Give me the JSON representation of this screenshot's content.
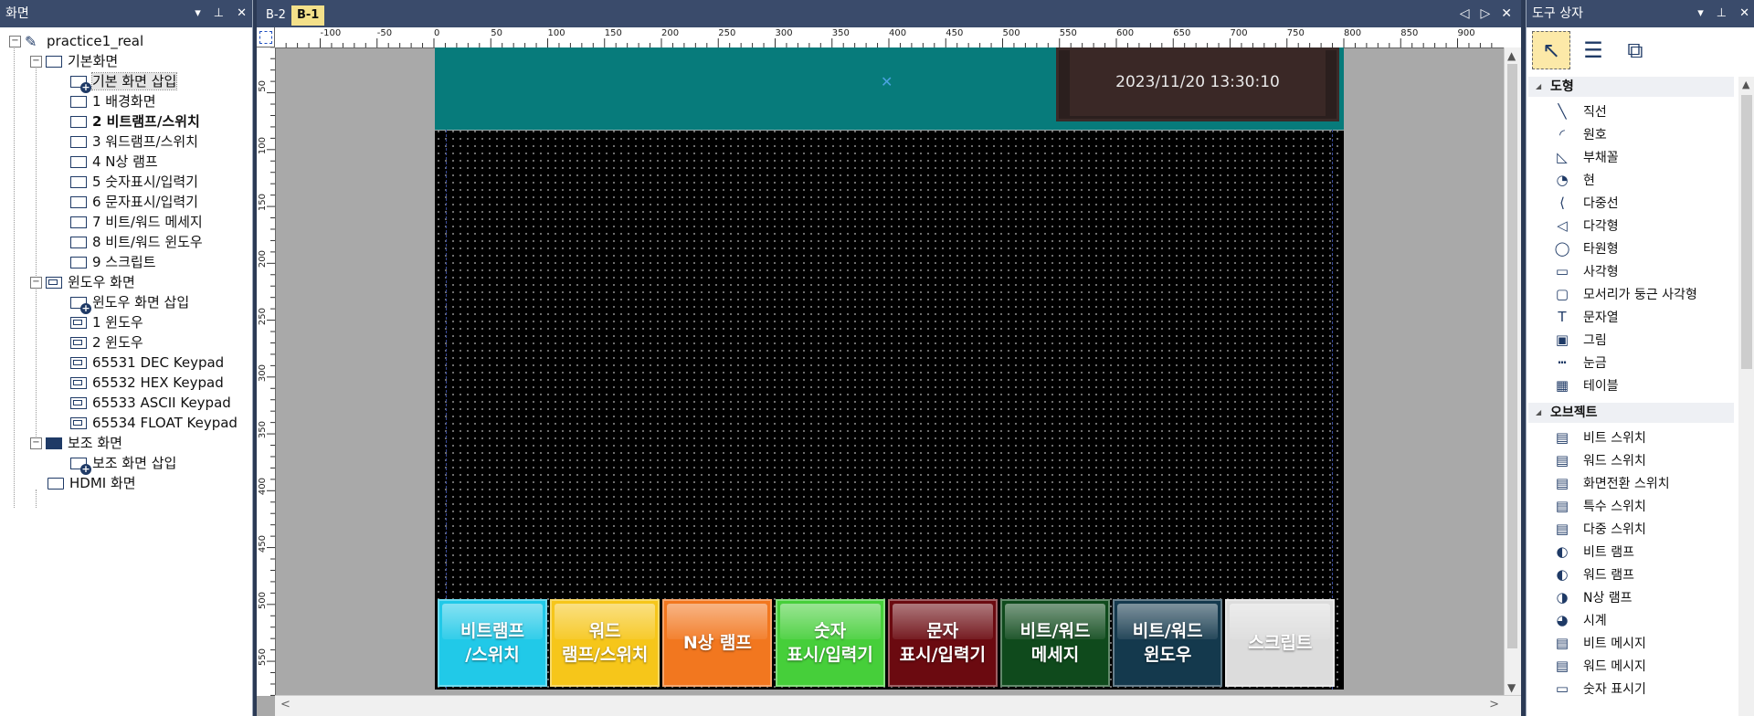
{
  "left_panel": {
    "title": "화면",
    "tree": {
      "project": "practice1_real",
      "base_group": "기본화면",
      "base_items": [
        "기본 화면 삽입",
        "1 배경화면",
        "2 비트램프/스위치",
        "3 워드램프/스위치",
        "4 N상 램프",
        "5 숫자표시/입력기",
        "6 문자표시/입력기",
        "7 비트/워드 메세지",
        "8 비트/워드 윈도우",
        "9 스크립트"
      ],
      "window_group": "윈도우 화면",
      "window_items": [
        "윈도우 화면 삽입",
        "1 윈도우",
        "2 윈도우",
        "65531 DEC Keypad",
        "65532 HEX Keypad",
        "65533 ASCII Keypad",
        "65534 FLOAT Keypad"
      ],
      "aux_group": "보조 화면",
      "aux_items": [
        "보조 화면 삽입"
      ],
      "hdmi": "HDMI 화면"
    }
  },
  "center": {
    "tabs": [
      "B-2",
      "B-1"
    ],
    "hruler_ticks": [
      "-100",
      "-50",
      "0",
      "50",
      "100",
      "150",
      "200",
      "250",
      "300",
      "350",
      "400",
      "450",
      "500",
      "550",
      "600",
      "650",
      "700",
      "750",
      "800",
      "850",
      "900"
    ],
    "vruler_ticks": [
      "50",
      "100",
      "150",
      "200",
      "250",
      "300",
      "350",
      "400",
      "450",
      "500",
      "550"
    ],
    "clock_text": "2023/11/20   13:30:10",
    "buttons": [
      {
        "label1": "비트램프",
        "label2": "/스위치",
        "color": "#21c9e8"
      },
      {
        "label1": "워드",
        "label2": "램프/스위치",
        "color": "#f6c61a"
      },
      {
        "label1": "N상 램프",
        "label2": "",
        "color": "#f2771f"
      },
      {
        "label1": "숫자",
        "label2": "표시/입력기",
        "color": "#46cf3a"
      },
      {
        "label1": "문자",
        "label2": "표시/입력기",
        "color": "#6b0a10"
      },
      {
        "label1": "비트/워드",
        "label2": "메세지",
        "color": "#0f4a1c"
      },
      {
        "label1": "비트/워드",
        "label2": "윈도우",
        "color": "#14394d"
      },
      {
        "label1": "스크립트",
        "label2": "",
        "color": "#dcdcdc"
      }
    ]
  },
  "right_panel": {
    "title": "도구 상자",
    "section_shapes": "도형",
    "shapes": [
      "직선",
      "원호",
      "부채꼴",
      "현",
      "다중선",
      "다각형",
      "타원형",
      "사각형",
      "모서리가 둥근 사각형",
      "문자열",
      "그림",
      "눈금",
      "테이블"
    ],
    "section_objects": "오브젝트",
    "objects": [
      "비트 스위치",
      "워드 스위치",
      "화면전환 스위치",
      "특수 스위치",
      "다중 스위치",
      "비트 램프",
      "워드 램프",
      "N상 램프",
      "시계",
      "비트 메시지",
      "워드 메시지",
      "숫자 표시기"
    ]
  }
}
